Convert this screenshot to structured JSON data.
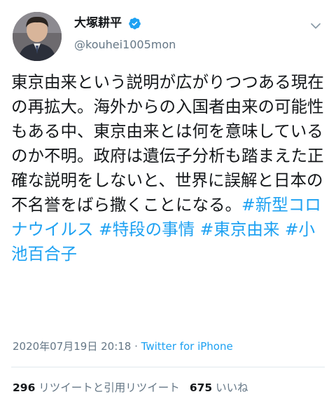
{
  "user": {
    "display_name": "大塚耕平",
    "handle": "@kouhei1005mon",
    "verified": true
  },
  "tweet": {
    "text": "東京由来という説明が広がりつつある現在の再拡大。海外からの入国者由来の可能性もある中、東京由来とは何を意味しているのか不明。政府は遺伝子分析も踏まえた正確な説明をしないと、世界に誤解と日本の不名誉をばら撒くことになる。",
    "hashtags": [
      "#新型コロナウイルス",
      "#特段の事情",
      "#東京由来",
      "#小池百合子"
    ],
    "timestamp": "2020年07月19日 20:18",
    "separator": " · ",
    "source": "Twitter for iPhone"
  },
  "stats": {
    "retweets_count": "296",
    "retweets_label": "リツイートと引用リツイート",
    "likes_count": "675",
    "likes_label": "いいね"
  },
  "icons": {
    "verified": "verified-badge-icon",
    "menu": "chevron-down-icon"
  },
  "colors": {
    "link": "#1da1f2",
    "secondary_text": "#657786",
    "primary_text": "#14171a"
  }
}
